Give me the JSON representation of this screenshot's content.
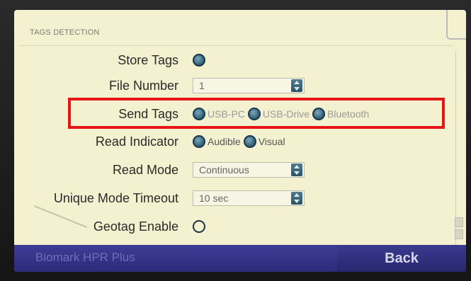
{
  "section_header": "TAGS DETECTION",
  "store_tags": {
    "label": "Store Tags"
  },
  "file_number": {
    "label": "File Number",
    "value": "1"
  },
  "send_tags": {
    "label": "Send Tags",
    "options": [
      "USB-PC",
      "USB-Drive",
      "Bluetooth"
    ]
  },
  "read_indicator": {
    "label": "Read Indicator",
    "options": [
      "Audible",
      "Visual"
    ]
  },
  "read_mode": {
    "label": "Read Mode",
    "value": "Continuous"
  },
  "unique_mode_timeout": {
    "label": "Unique Mode Timeout",
    "value": "10 sec"
  },
  "geotag_enable": {
    "label": "Geotag Enable"
  },
  "footer": {
    "brand": "Biomark HPR Plus",
    "back_label": "Back"
  },
  "colors": {
    "screen_bg": "#f3f1cf",
    "highlight": "#e61616",
    "footer_bg": "#2b2b7a"
  }
}
